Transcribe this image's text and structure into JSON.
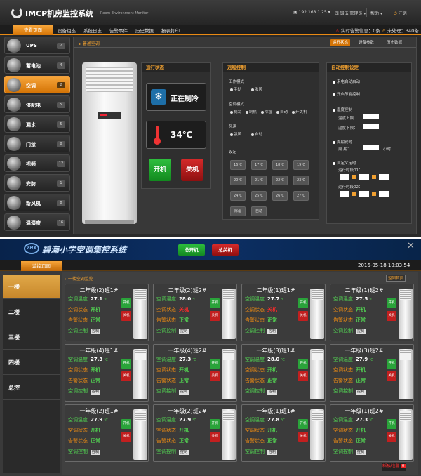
{
  "top": {
    "app_title": "IMCP机房监控系统",
    "app_subtitle": "Room Environment Monitor",
    "ip": "192.168.1.25",
    "user": "管理员",
    "help": "帮助",
    "logout": "注销",
    "nav": [
      "查看页面",
      "设备组态",
      "系统日志",
      "告警事件",
      "历史数据",
      "报表打印"
    ],
    "alarm_realtime": "实时告警信息：",
    "alarm_realtime_count": "0条",
    "alarm_unhandled": "未处理：",
    "alarm_unhandled_count": "340条",
    "sidebar": [
      {
        "label": "UPS",
        "count": "2"
      },
      {
        "label": "蓄电池",
        "count": "4"
      },
      {
        "label": "空调",
        "count": "2"
      },
      {
        "label": "供配电",
        "count": "5"
      },
      {
        "label": "漏水",
        "count": "5"
      },
      {
        "label": "门禁",
        "count": "8"
      },
      {
        "label": "视频",
        "count": "12"
      },
      {
        "label": "安防",
        "count": "1"
      },
      {
        "label": "新风机",
        "count": "8"
      },
      {
        "label": "温湿度",
        "count": "16"
      }
    ],
    "crumb": "普通空调",
    "tool_buttons": [
      "运行状态",
      "设备参数",
      "历史数据"
    ],
    "status_box": {
      "title": "运行状态",
      "mode_status": "正在制冷",
      "temperature": "34℃",
      "on_label": "开机",
      "off_label": "关机"
    },
    "remote_box": {
      "title": "远程控制",
      "work_mode_label": "工作模式",
      "work_modes": [
        "手动",
        "发风"
      ],
      "ac_mode_label": "空调模式",
      "ac_modes": [
        "制冷",
        "制热",
        "除湿",
        "自动",
        "开关机"
      ],
      "fan_label": "风速",
      "fan_modes": [
        "强风",
        "自动"
      ],
      "set_label": "设定",
      "temps": [
        "16℃",
        "17℃",
        "18℃",
        "19℃",
        "20℃",
        "21℃",
        "22℃",
        "23℃",
        "24℃",
        "25℃",
        "26℃",
        "27℃"
      ],
      "extra_buttons": [
        "除湿",
        "自动"
      ]
    },
    "auto_box": {
      "title": "自动控制设定",
      "opt1": "来电自动启动",
      "opt2": "开启节能控制",
      "temp_ctrl": "温度控制",
      "temp_upper": "温度上限：",
      "temp_lower": "温度下限：",
      "cycle": "周期轮时",
      "cycle_label": "周    期：",
      "cycle_unit": "小时",
      "custom": "自定义定时",
      "run_time_1": "运行时段01：",
      "run_time_2": "运行时段02："
    }
  },
  "bottom": {
    "logo_text": "ZHX",
    "title": "碧海小学空调集控系统",
    "all_on": "总开机",
    "all_off": "总关机",
    "close": "✕",
    "tab": "监控页面",
    "time": "2016-05-18 10:03:54",
    "floors": [
      "一楼",
      "二楼",
      "三楼",
      "四楼",
      "总控"
    ],
    "crumb": "一楼空调监控",
    "back": "返回首页",
    "labels": {
      "temp": "空调温度",
      "state": "空调状态",
      "alarm": "告警状态",
      "ctrl": "空调控制",
      "ctrl_btn": "控制",
      "on": "开机",
      "off": "关机",
      "unit": "℃"
    },
    "cards": [
      {
        "name": "二年级(2)班1#",
        "temp": "27.1",
        "state": "开机",
        "state_color": "green",
        "alarm": "正常"
      },
      {
        "name": "二年级(2)班2#",
        "temp": "28.0",
        "state": "关机",
        "state_color": "red",
        "alarm": "正常"
      },
      {
        "name": "二年级(1)班1#",
        "temp": "27.7",
        "state": "关机",
        "state_color": "red",
        "alarm": "正常"
      },
      {
        "name": "二年级(1)班2#",
        "temp": "27.5",
        "state": "开机",
        "state_color": "green",
        "alarm": "正常"
      },
      {
        "name": "一年级(4)班1#",
        "temp": "27.3",
        "state": "开机",
        "state_color": "green",
        "alarm": "正常"
      },
      {
        "name": "一年级(4)班2#",
        "temp": "27.3",
        "state": "开机",
        "state_color": "green",
        "alarm": "正常"
      },
      {
        "name": "一年级(3)班1#",
        "temp": "28.0",
        "state": "开机",
        "state_color": "green",
        "alarm": "正常"
      },
      {
        "name": "一年级(3)班2#",
        "temp": "27.9",
        "state": "开机",
        "state_color": "green",
        "alarm": "正常"
      },
      {
        "name": "一年级(2)班1#",
        "temp": "27.9",
        "state": "开机",
        "state_color": "green",
        "alarm": "正常"
      },
      {
        "name": "一年级(2)班2#",
        "temp": "27.9",
        "state": "开机",
        "state_color": "green",
        "alarm": "正常"
      },
      {
        "name": "一年级(1)班1#",
        "temp": "27.8",
        "state": "开机",
        "state_color": "green",
        "alarm": "正常"
      },
      {
        "name": "一年级(1)班2#",
        "temp": "27.3",
        "state": "开机",
        "state_color": "green",
        "alarm": "正常"
      }
    ],
    "alarm_label": "未确认告警",
    "alarm_count": "0"
  }
}
